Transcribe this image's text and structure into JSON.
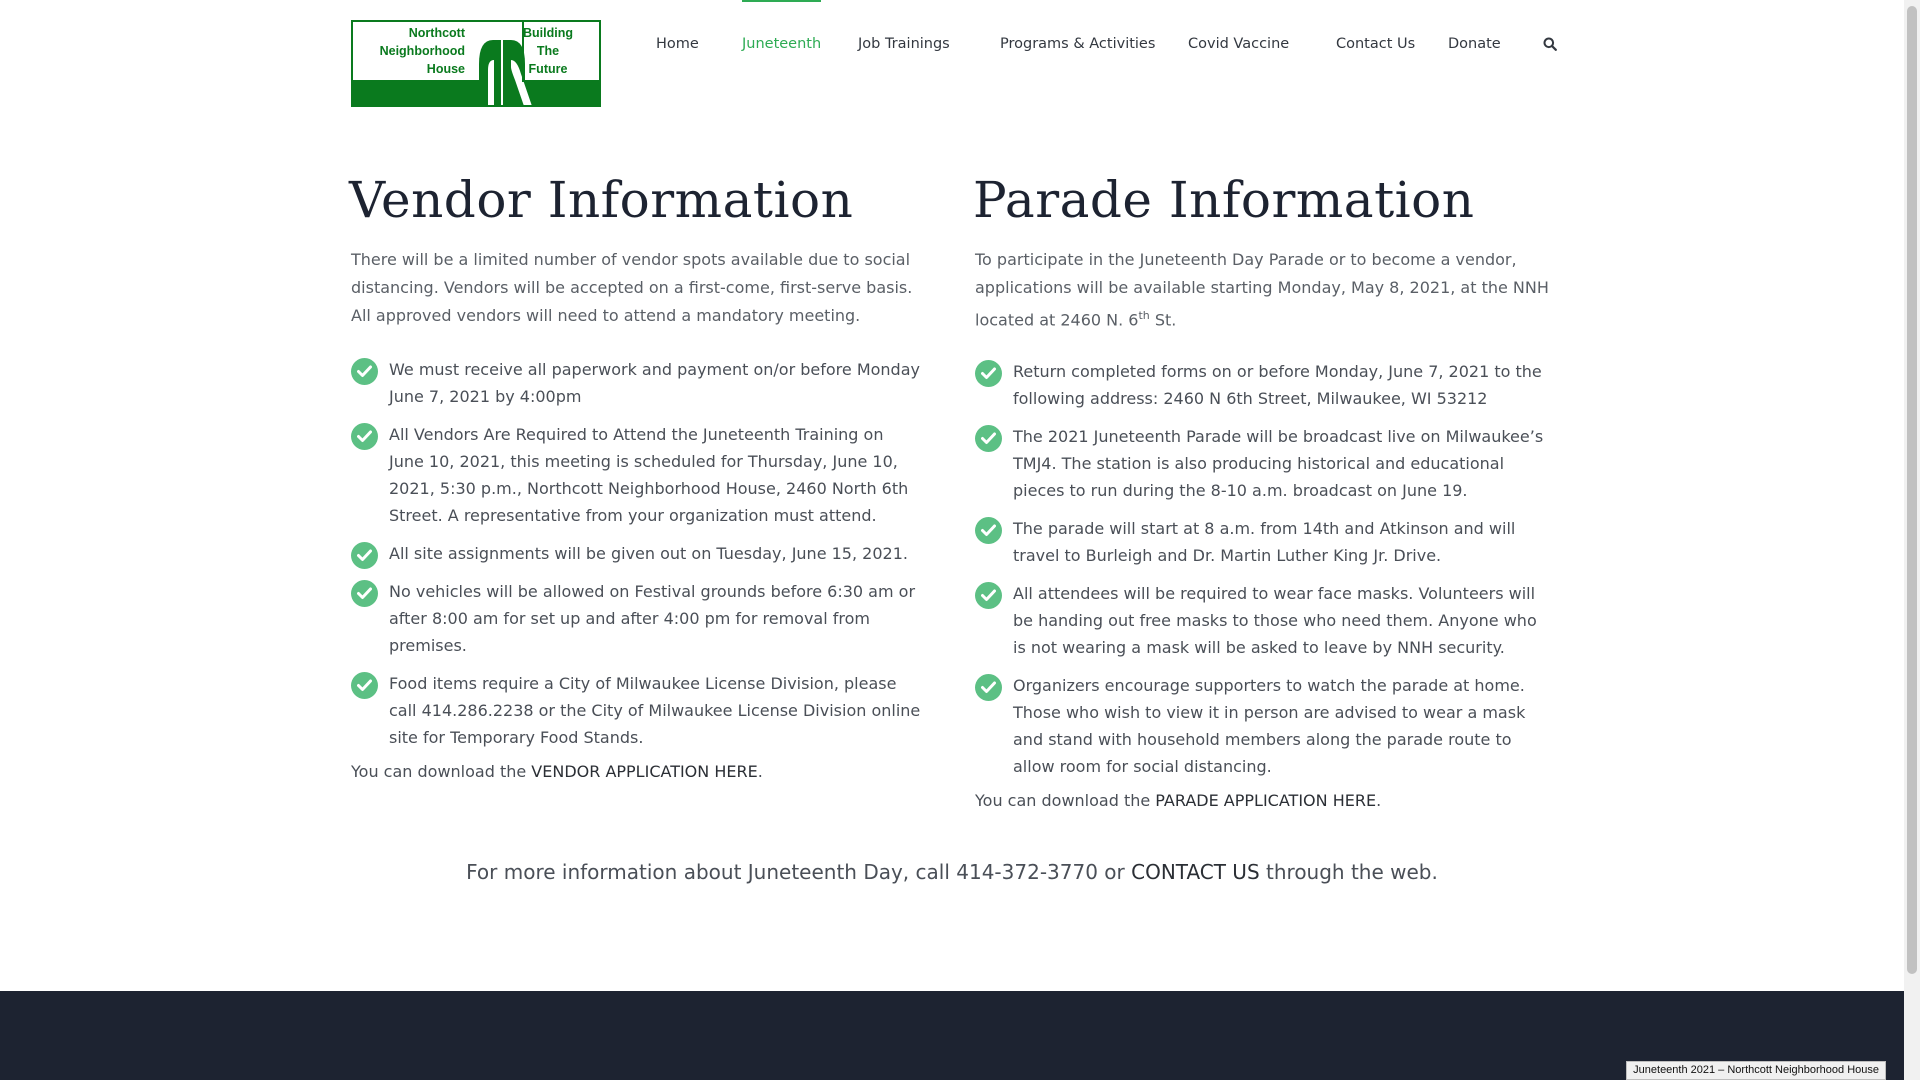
{
  "logo": {
    "left_lines": [
      "Northcott",
      "Neighborhood",
      "House"
    ],
    "right_lines": [
      "Building",
      "The",
      "Future"
    ],
    "brand_color": "#0a7a1e"
  },
  "nav": {
    "items": [
      {
        "label": "Home"
      },
      {
        "label": "Juneteenth",
        "active": true
      },
      {
        "label": "Job Trainings"
      },
      {
        "label": "Programs & Activities"
      },
      {
        "label": "Covid Vaccine"
      },
      {
        "label": "Contact Us"
      },
      {
        "label": "Donate"
      }
    ],
    "search_icon": "search-icon",
    "active_color": "#2eab54"
  },
  "vendor": {
    "title": "Vendor Information",
    "intro": "There will be a limited number of vendor spots available due to social distancing. Vendors will be accepted on a first-come, first-serve basis. All approved vendors will need to attend a mandatory meeting.",
    "items": [
      "We must receive all paperwork and payment on/or before Monday June 7, 2021 by 4:00pm",
      "All Vendors Are Required to Attend the Juneteenth Training on June 10, 2021, this meeting is scheduled for Thursday, June 10, 2021, 5:30 p.m., Northcott Neighborhood House, 2460 North 6th Street. A representative from your organization must attend.",
      "All site assignments will be given out on Tuesday, June 15, 2021.",
      "No vehicles will be allowed on Festival grounds before 6:30 am or after 8:00 am for set up and after 4:00 pm for removal from premises.",
      "Food items require a City of Milwaukee License Division, please call 414.286.2238 or the City of Milwaukee License Division online site for Temporary Food Stands."
    ],
    "download_prefix": "You can download the ",
    "download_link": "VENDOR APPLICATION HERE",
    "download_suffix": "."
  },
  "parade": {
    "title": "Parade Information",
    "intro_main": "To participate in the Juneteenth Day Parade or to become a vendor, applications will be available starting Monday, May 8, 2021, at the NNH located at 2460 N. 6",
    "intro_sup": "th",
    "intro_end": " St.",
    "items": [
      "Return completed forms on or before Monday, June 7, 2021 to the following address: 2460 N 6th Street, Milwaukee, WI 53212",
      "The 2021 Juneteenth Parade will be broadcast live on Milwaukee’s TMJ4. The station is also producing historical and educational pieces to run during the 8-10 a.m. broadcast on June 19.",
      "The parade will start at 8 a.m. from 14th and Atkinson and will travel to Burleigh and Dr. Martin Luther King Jr. Drive.",
      "All attendees will be required to wear face masks. Volunteers will be handing out free masks to those who need them. Anyone who is not wearing a mask will be asked to leave by NNH security.",
      "Organizers encourage supporters to watch the parade at home. Those who wish to view it in person are advised to wear a mask and stand with household members along the parade route to allow room for social distancing."
    ],
    "download_prefix": "You can download the ",
    "download_link": "PARADE APPLICATION HERE",
    "download_suffix": "."
  },
  "more_info": {
    "prefix": "For more information about Juneteenth Day, call 414-372-3770 or ",
    "link": "CONTACT US",
    "suffix": " through the web."
  },
  "status_bar": "Juneteenth 2021 – Northcott Neighborhood House",
  "colors": {
    "check": "#5cc084",
    "footer": "#1d2331",
    "heading": "#1d2331"
  }
}
